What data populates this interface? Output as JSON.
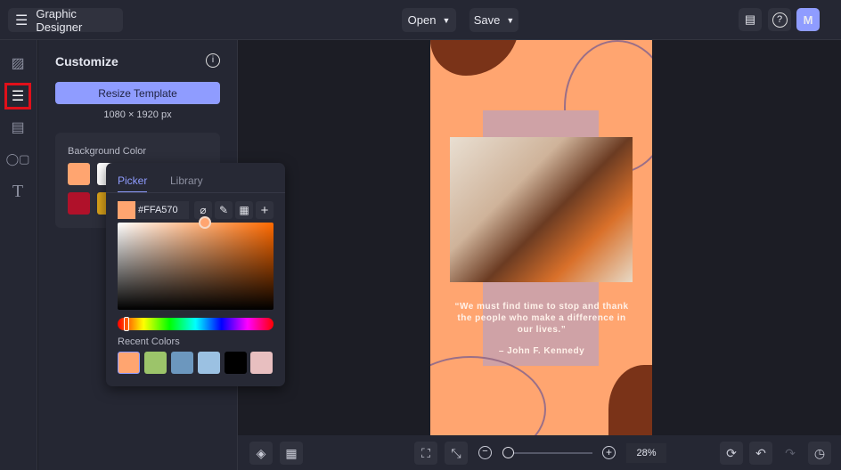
{
  "header": {
    "app_title": "Graphic Designer",
    "open_label": "Open",
    "save_label": "Save",
    "avatar_initial": "M"
  },
  "rail": {
    "items": [
      "image-icon",
      "customize-icon",
      "layout-icon",
      "shapes-icon",
      "text-icon"
    ],
    "active": "customize-icon"
  },
  "panel": {
    "title": "Customize",
    "resize_label": "Resize Template",
    "dimensions": "1080 × 1920 px",
    "bg_color_label": "Background Color",
    "swatches": [
      "#FFA570",
      "#FFFFFF",
      "#B0112A",
      "#D9A21B"
    ]
  },
  "picker": {
    "tabs": [
      "Picker",
      "Library"
    ],
    "active_tab": "Picker",
    "hex": "#FFA570",
    "hue_fraction": 0.06,
    "recent_label": "Recent Colors",
    "recent_colors": [
      "#FFA570",
      "#9CC46A",
      "#6C97BE",
      "#9BC1E2",
      "#000000",
      "#E8BFC0"
    ]
  },
  "design": {
    "background": "#FFA570",
    "quote": "“We must find time to stop and thank the people who make a difference in our lives.”",
    "author": "– John F. Kennedy"
  },
  "bottom": {
    "zoom": "28%",
    "zoom_fraction": 0.05
  }
}
